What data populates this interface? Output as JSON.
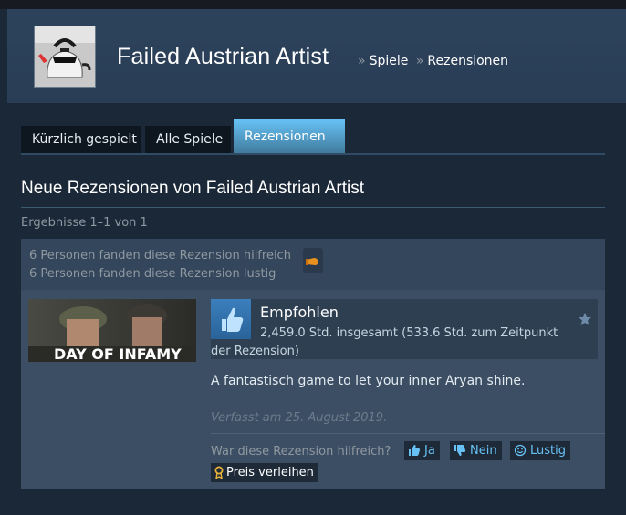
{
  "profile": {
    "name": "Failed Austrian Artist",
    "breadcrumb": [
      {
        "label": "Spiele"
      },
      {
        "label": "Rezensionen"
      }
    ],
    "breadcrumb_separator": "»"
  },
  "tabs": [
    {
      "label": "Kürzlich gespielt",
      "active": false
    },
    {
      "label": "Alle Spiele",
      "active": false
    },
    {
      "label": "Rezensionen",
      "active": true
    }
  ],
  "section": {
    "title": "Neue Rezensionen von Failed Austrian Artist",
    "results": "Ergebnisse 1–1 von 1"
  },
  "review": {
    "helpful_count_text": "6 Personen fanden diese Rezension hilfreich",
    "funny_count_text": "6 Personen fanden diese Rezension lustig",
    "game_title_art": "DAY OF INFAMY",
    "recommendation": "Empfohlen",
    "hours_line1": "2,459.0 Std. insgesamt (533.6 Std. zum Zeitpunkt",
    "hours_line2": "der Rezension)",
    "text": "A fantastisch game to let your inner Aryan shine.",
    "posted": "Verfasst am 25. August 2019.",
    "helpful_question": "War diese Rezension hilfreich?",
    "buttons": {
      "yes": "Ja",
      "no": "Nein",
      "funny": "Lustig",
      "award": "Preis verleihen"
    }
  },
  "colors": {
    "background": "#1b2838",
    "accent": "#66c0f4",
    "link": "#67c1f5",
    "recommend_blue": "#3b7fbd"
  },
  "icons": {
    "avatar": "kettle-avatar",
    "award": "award-hand-icon",
    "recommend": "thumbs-up-icon",
    "favorite": "star-icon",
    "yes": "thumbs-up-icon",
    "no": "thumbs-down-icon",
    "funny": "smiley-icon",
    "award_button": "ribbon-icon"
  }
}
